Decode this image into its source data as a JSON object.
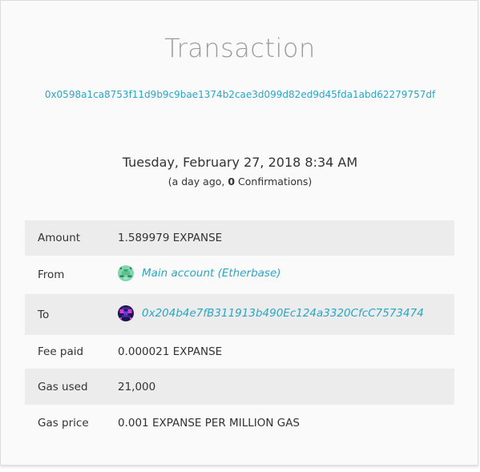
{
  "page": {
    "title": "Transaction",
    "tx_hash": "0x0598a1ca8753f11d9b9c9bae1374b2cae3d099d82ed9d45fda1abd62279757df",
    "datetime": "Tuesday, February 27, 2018 8:34 AM",
    "age_prefix": "(a day ago, ",
    "confirmations_count": "0",
    "confirmations_suffix": " Confirmations)"
  },
  "details": {
    "amount": {
      "label": "Amount",
      "value": "1.589979 EXPANSE"
    },
    "from": {
      "label": "From",
      "value": "Main account (Etherbase)",
      "icon": "identicon-green"
    },
    "to": {
      "label": "To",
      "value": "0x204b4e7fB311913b490Ec124a3320CfcC7573474",
      "icon": "identicon-purple"
    },
    "fee_paid": {
      "label": "Fee paid",
      "value": "0.000021 EXPANSE"
    },
    "gas_used": {
      "label": "Gas used",
      "value": "21,000"
    },
    "gas_price": {
      "label": "Gas price",
      "value": "0.001 EXPANSE PER MILLION GAS"
    }
  },
  "colors": {
    "link": "#2aa6c3",
    "title": "#9b9b9b",
    "row_shade": "#ececec",
    "background": "#fafafa"
  }
}
